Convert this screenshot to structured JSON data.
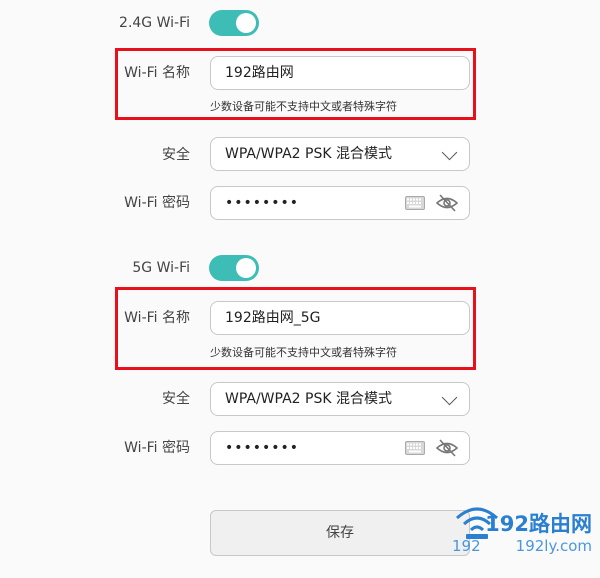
{
  "wifi24": {
    "toggle_label": "2.4G Wi-Fi",
    "enabled": true,
    "name_label": "Wi-Fi 名称",
    "name_value": "192路由网",
    "name_hint": "少数设备可能不支持中文或者特殊字符",
    "security_label": "安全",
    "security_value": "WPA/WPA2 PSK 混合模式",
    "password_label": "Wi-Fi 密码",
    "password_value": "••••••••"
  },
  "wifi5": {
    "toggle_label": "5G Wi-Fi",
    "enabled": true,
    "name_label": "Wi-Fi 名称",
    "name_value": "192路由网_5G",
    "name_hint": "少数设备可能不支持中文或者特殊字符",
    "security_label": "安全",
    "security_value": "WPA/WPA2 PSK 混合模式",
    "password_label": "Wi-Fi 密码",
    "password_value": "••••••••"
  },
  "save_label": "保存",
  "watermark": {
    "brand": "192路由网",
    "site_prefix": "192",
    "site": "192ly.com"
  },
  "colors": {
    "toggle_on": "#3dbdb5",
    "highlight_box": "#e8101a",
    "watermark": "#2a7fd0"
  },
  "icons": [
    "chevron-down-icon",
    "keyboard-icon",
    "eye-hidden-icon",
    "wifi-icon"
  ]
}
